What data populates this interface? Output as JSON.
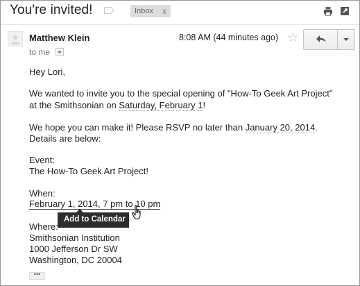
{
  "subject": "You're invited!",
  "label_chip": {
    "label": "Inbox",
    "remove": "x"
  },
  "toolbar": {
    "print_icon": "print-icon",
    "popout_icon": "new-window-icon"
  },
  "header": {
    "sender": "Matthew Klein",
    "time": "8:08 AM (44 minutes ago)",
    "to": "to me",
    "star_glyph": "☆"
  },
  "body": {
    "greeting": "Hey Lori,",
    "para1_line1": "We wanted to invite you to the special opening of \"How-To Geek Art Project\"",
    "para1_line2_a": "at the Smithsonian on ",
    "para1_line2_date": "Saturday, February 1",
    "para1_line2_b": "!",
    "para2_line1_a": "We hope you can make it! Please RSVP no later than ",
    "para2_line1_date": "January 20, 2014",
    "para2_line1_b": ".",
    "para2_line2": "Details are below:",
    "event_label": "Event:",
    "event_name": "The How-To Geek Art Project!",
    "when_label": "When:",
    "when_value": "February 1, 2014, 7 pm to 10 pm",
    "where_label": "Where:",
    "address_line1": "Smithsonian Institution",
    "address_line2": "1000 Jefferson Dr SW",
    "address_line3": "Washington, DC 20004",
    "trimmed_content": "•••"
  },
  "tooltip": "Add to Calendar"
}
